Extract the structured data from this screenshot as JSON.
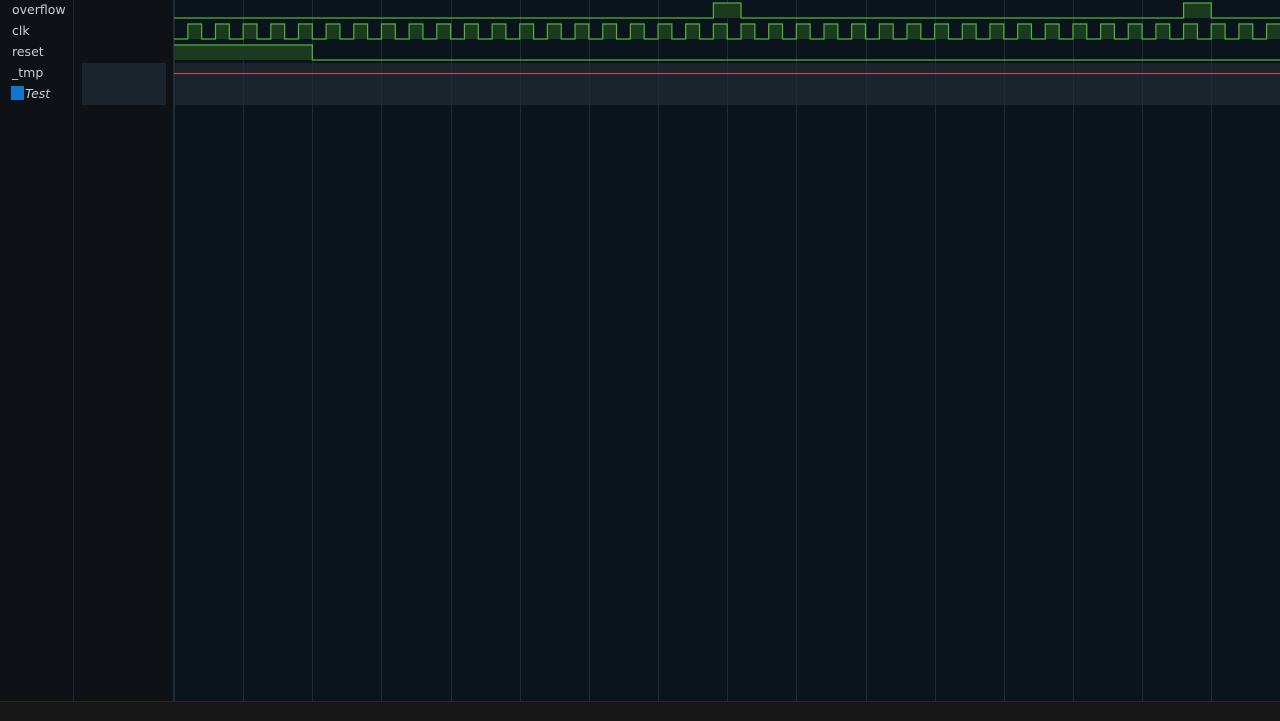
{
  "signals": [
    {
      "name": "overflow",
      "type": "bit",
      "color": "#4fb33d",
      "fill": "#1c3a1f",
      "events": [
        [
          0,
          0
        ],
        [
          39,
          1
        ],
        [
          41,
          0
        ],
        [
          73,
          1
        ],
        [
          75,
          0
        ]
      ]
    },
    {
      "name": "clk",
      "type": "clock",
      "color": "#4fb33d",
      "fill": "#1c3a1f",
      "half_period": 1,
      "start_high": 1
    },
    {
      "name": "reset",
      "type": "bit",
      "color": "#4fb33d",
      "fill": "#1c3a1f",
      "events": [
        [
          0,
          1
        ],
        [
          10,
          0
        ]
      ]
    },
    {
      "name": "_tmp",
      "type": "undefined",
      "color": "#d9444f"
    },
    {
      "name": "Test",
      "type": "group",
      "italic": true,
      "selected": true
    }
  ],
  "time_axis": {
    "start": 0,
    "end": 80,
    "grid_interval": 5
  },
  "colors": {
    "background": "#0b141c",
    "grid": "#1f2c37",
    "selected_row": "#1b242d",
    "selection_marker": "#1177cc"
  }
}
